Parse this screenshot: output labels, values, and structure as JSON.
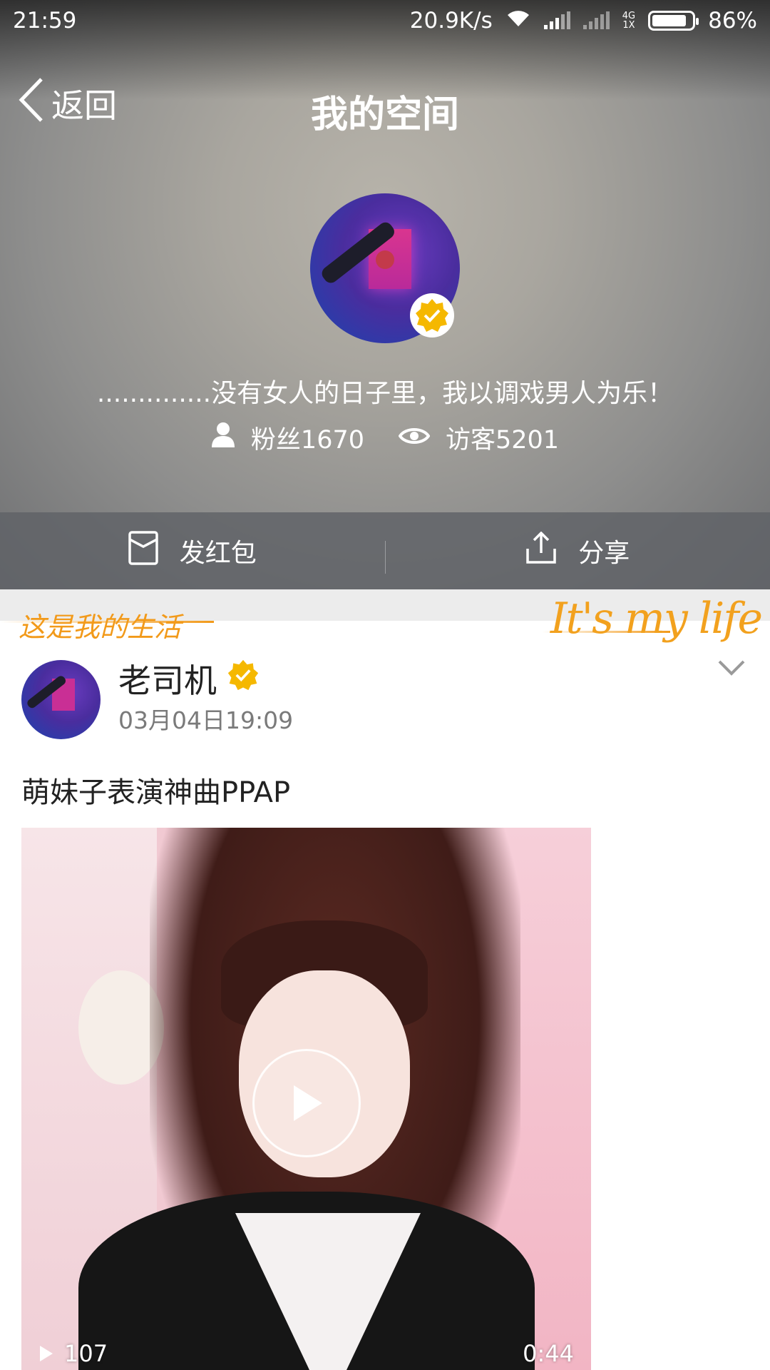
{
  "status_bar": {
    "time": "21:59",
    "speed": "20.9K/s",
    "network_label_top": "4G",
    "network_label_bottom": "1X",
    "battery": "86%",
    "battery_level": 0.86
  },
  "nav": {
    "back_label": "返回",
    "title": "我的空间"
  },
  "profile": {
    "bio": "..............没有女人的日子里，我以调戏男人为乐！",
    "fans": "粉丝1670",
    "visitors": "访客5201"
  },
  "actions": {
    "red_packet": "发红包",
    "share": "分享"
  },
  "banner": {
    "left_text": "这是我的生活",
    "right_text": "It's my life"
  },
  "post": {
    "author": "老司机",
    "time": "03月04日19:09",
    "text": "萌妹子表演神曲PPAP",
    "video": {
      "play_count": "107",
      "duration": "0:44"
    }
  },
  "colors": {
    "verified": "#f5b800",
    "banner_orange": "#f29a1a"
  }
}
